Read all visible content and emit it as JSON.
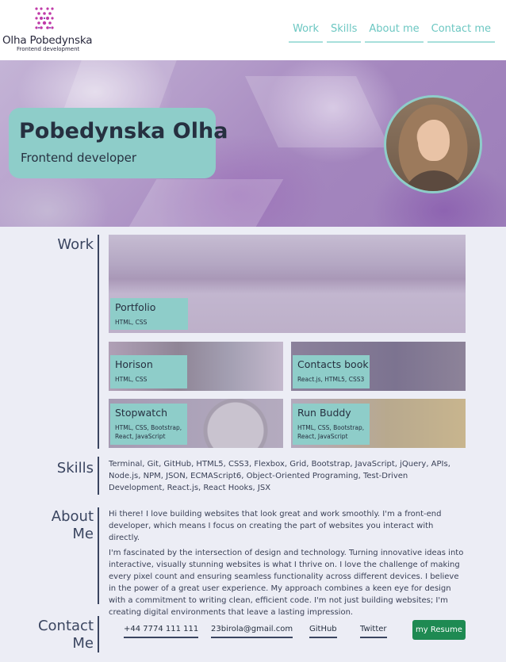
{
  "logo": {
    "name": "Olha Pobedynska",
    "subtitle": "Frontend development"
  },
  "nav": {
    "items": [
      "Work",
      "Skills",
      "About me",
      "Contact me"
    ]
  },
  "hero": {
    "name": "Pobedynska Olha",
    "role": "Frontend developer"
  },
  "sections": {
    "work_title": "Work",
    "skills_title": "Skills",
    "about_title_1": "About",
    "about_title_2": "Me",
    "contact_title_1": "Contact",
    "contact_title_2": "Me"
  },
  "projects": [
    {
      "title": "Portfolio",
      "tech": "HTML, CSS"
    },
    {
      "title": "Horison",
      "tech": "HTML, CSS"
    },
    {
      "title": "Contacts book",
      "tech": "React.js, HTML5, CSS3"
    },
    {
      "title": "Stopwatch",
      "tech": "HTML, CSS, Bootstrap, React, JavaScript"
    },
    {
      "title": "Run Buddy",
      "tech": "HTML, CSS, Bootstrap, React, JavaScript"
    }
  ],
  "skills": "Terminal, Git, GitHub, HTML5, CSS3, Flexbox, Grid, Bootstrap, JavaScript, jQuery, APIs, Node.js, NPM, JSON, ECMAScript6, Object-Oriented Programing, Test-Driven Development, React.js, React Hooks, JSX",
  "about": [
    "Hi there! I love building websites that look great and work smoothly. I'm a front-end developer, which means I focus on creating the part of websites you interact with directly.",
    "I'm fascinated by the intersection of design and technology. Turning innovative ideas into interactive, visually stunning websites is what I thrive on. I love the challenge of making every pixel count and ensuring seamless functionality across different devices. I believe in the power of a great user experience. My approach combines a keen eye for design with a commitment to writing clean, efficient code. I'm not just building websites; I'm creating digital environments that leave a lasting impression."
  ],
  "contact": {
    "phone": "+44 7774 111 111",
    "email": "23birola@gmail.com",
    "github": "GitHub",
    "twitter": "Twitter",
    "resume": "my Resume"
  },
  "colors": {
    "accent": "#8ecdc9",
    "nav_text": "#6cc7c2",
    "resume_button": "#1e8a52",
    "background": "#ecedf5"
  }
}
